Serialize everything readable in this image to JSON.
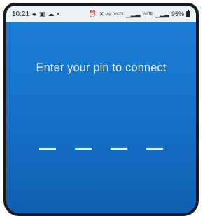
{
  "status_bar": {
    "time": "10:21",
    "left_icons": [
      "notification-icon",
      "cast-icon",
      "cloud-icon",
      "dot-icon"
    ],
    "right_icons": [
      "alarm-icon",
      "mute-icon",
      "wifi-icon",
      "signal-icon",
      "signal-icon"
    ],
    "volte_label_1": "VoLTE",
    "volte_label_2": "VoLTE",
    "battery_text": "95%"
  },
  "main": {
    "prompt": "Enter your pin to connect",
    "pin_length": 4
  },
  "colors": {
    "background_top": "#1c7fd6",
    "background_bottom": "#0f5fb0",
    "status_bar": "#eef1f4",
    "text": "#eaf3fb"
  }
}
